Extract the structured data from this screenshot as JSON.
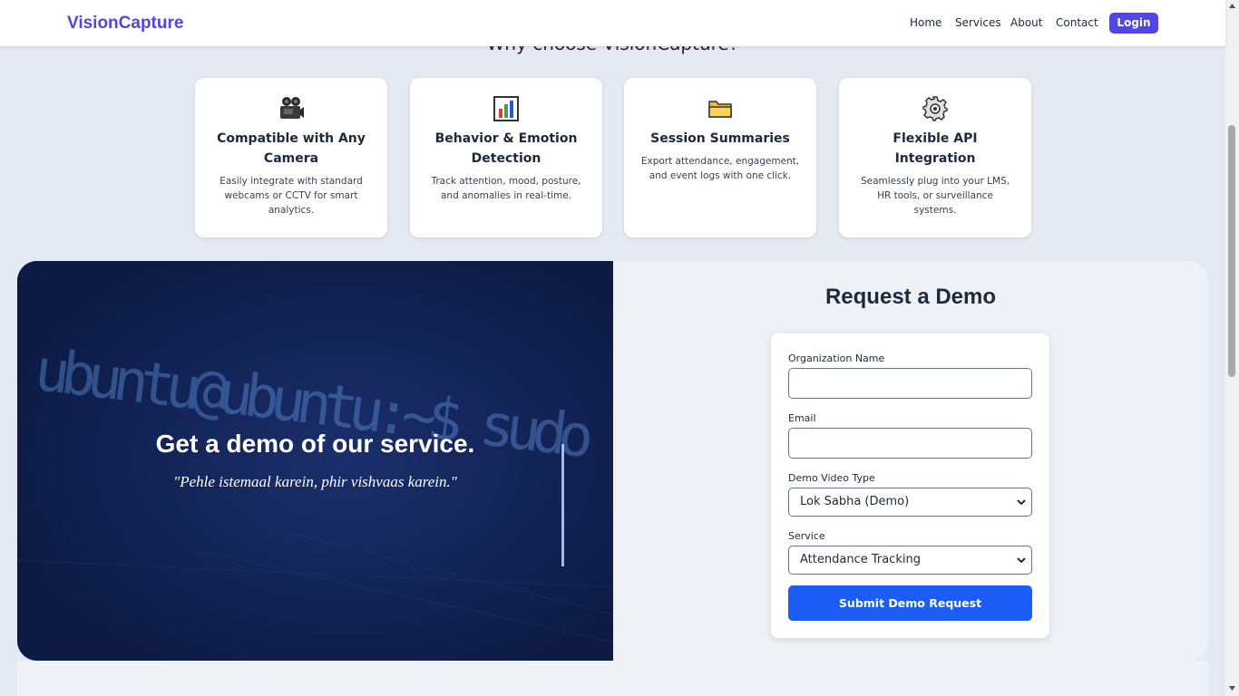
{
  "navbar": {
    "brand": "VisionCapture",
    "links": [
      "Home",
      "Services",
      "About",
      "Contact"
    ],
    "login_label": "Login"
  },
  "features": {
    "heading": "Why choose VisionCapture?",
    "cards": [
      {
        "icon": "movie-camera-icon",
        "title": "Compatible with Any Camera",
        "desc": "Easily integrate with standard webcams or CCTV for smart analytics."
      },
      {
        "icon": "bar-chart-icon",
        "title": "Behavior & Emotion Detection",
        "desc": "Track attention, mood, posture, and anomalies in real-time."
      },
      {
        "icon": "folder-icon",
        "title": "Session Summaries",
        "desc": "Export attendance, engagement, and event logs with one click."
      },
      {
        "icon": "gear-icon",
        "title": "Flexible API Integration",
        "desc": "Seamlessly plug into your LMS, HR tools, or surveillance systems."
      }
    ]
  },
  "demo": {
    "hero_title": "Get a demo of our service.",
    "hero_quote": "\"Pehle istemaal karein, phir vishvaas karein.\"",
    "hero_bg_text": "ubuntu@ubuntu:~$ sudo",
    "form_heading": "Request a Demo",
    "fields": {
      "org_label": "Organization Name",
      "org_value": "",
      "email_label": "Email",
      "email_value": "",
      "video_type_label": "Demo Video Type",
      "video_type_value": "Lok Sabha (Demo)",
      "service_label": "Service",
      "service_value": "Attendance Tracking"
    },
    "submit_label": "Submit Demo Request"
  },
  "colors": {
    "brand": "#4f46e5",
    "hero_bg": "#101f4c",
    "submit": "#1c5ef5",
    "page_bg": "#e5e9f1"
  }
}
